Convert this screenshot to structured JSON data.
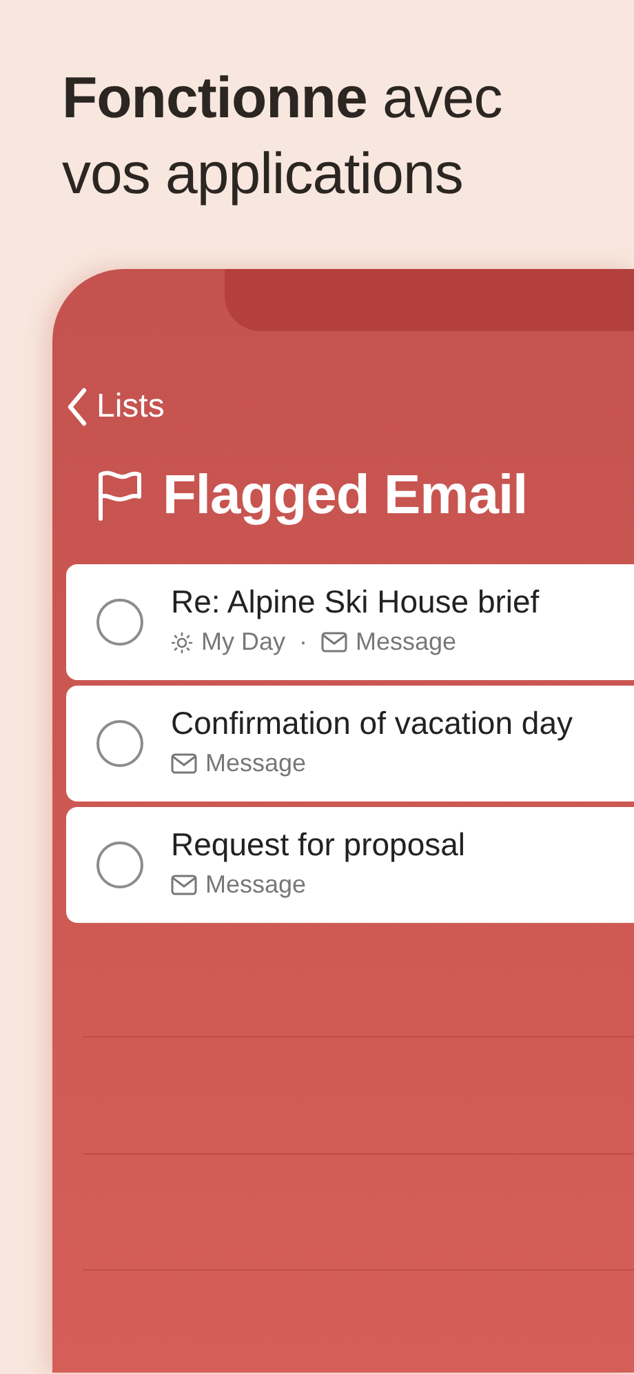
{
  "headline": "**Fonctionne** avec vos applications",
  "nav": {
    "back_label": "Lists"
  },
  "list": {
    "title": "Flagged Email"
  },
  "tasks": [
    {
      "title": "Re: Alpine Ski House brief",
      "checked": false,
      "meta": [
        {
          "kind": "my_day",
          "label": "My Day"
        },
        {
          "kind": "separator",
          "label": "·"
        },
        {
          "kind": "message",
          "label": "Message"
        }
      ]
    },
    {
      "title": "Confirmation of vacation day",
      "checked": false,
      "meta": [
        {
          "kind": "message",
          "label": "Message"
        }
      ]
    },
    {
      "title": "Request for proposal",
      "checked": false,
      "meta": [
        {
          "kind": "message",
          "label": "Message"
        }
      ]
    }
  ]
}
